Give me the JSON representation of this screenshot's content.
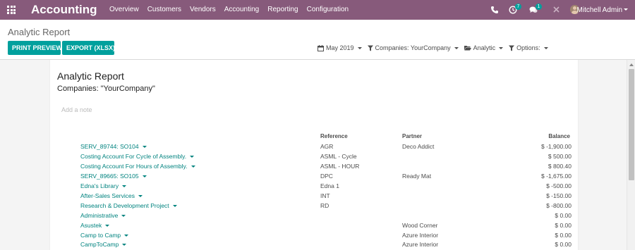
{
  "navbar": {
    "app_title": "Accounting",
    "menu": [
      "Overview",
      "Customers",
      "Vendors",
      "Accounting",
      "Reporting",
      "Configuration"
    ],
    "activity_count": "7",
    "message_count": "1",
    "user_name": "Mitchell Admin"
  },
  "control_panel": {
    "title": "Analytic Report",
    "print_label": "PRINT PREVIEW",
    "export_label": "EXPORT (XLSX)",
    "filters": {
      "date": "May 2019",
      "companies": "Companies: YourCompany",
      "analytic": "Analytic",
      "options": "Options:"
    }
  },
  "report": {
    "title": "Analytic Report",
    "subtitle": "Companies: \"YourCompany\"",
    "note_placeholder": "Add a note",
    "columns": {
      "reference": "Reference",
      "partner": "Partner",
      "balance": "Balance"
    },
    "rows": [
      {
        "name": "SERV_89744: SO104",
        "reference": "AGR",
        "partner": "Deco Addict",
        "balance": "$ -1,900.00"
      },
      {
        "name": "Costing Account For Cycle of Assembly.",
        "reference": "ASML - Cycle",
        "partner": "",
        "balance": "$ 500.00"
      },
      {
        "name": "Costing Account For Hours of Assembly.",
        "reference": "ASML - HOUR",
        "partner": "",
        "balance": "$ 800.40"
      },
      {
        "name": "SERV_89665: SO105",
        "reference": "DPC",
        "partner": "Ready Mat",
        "balance": "$ -1,675.00"
      },
      {
        "name": "Edna's Library",
        "reference": "Edna 1",
        "partner": "",
        "balance": "$ -500.00"
      },
      {
        "name": "After-Sales Services",
        "reference": "INT",
        "partner": "",
        "balance": "$ -150.00"
      },
      {
        "name": "Research & Development Project",
        "reference": "RD",
        "partner": "",
        "balance": "$ -800.00"
      },
      {
        "name": "Administrative",
        "reference": "",
        "partner": "",
        "balance": "$ 0.00"
      },
      {
        "name": "Asustek",
        "reference": "",
        "partner": "Wood Corner",
        "balance": "$ 0.00"
      },
      {
        "name": "Camp to Camp",
        "reference": "",
        "partner": "Azure Interior",
        "balance": "$ 0.00"
      },
      {
        "name": "CampToCamp",
        "reference": "",
        "partner": "Azure Interior",
        "balance": "$ 0.00"
      }
    ]
  }
}
